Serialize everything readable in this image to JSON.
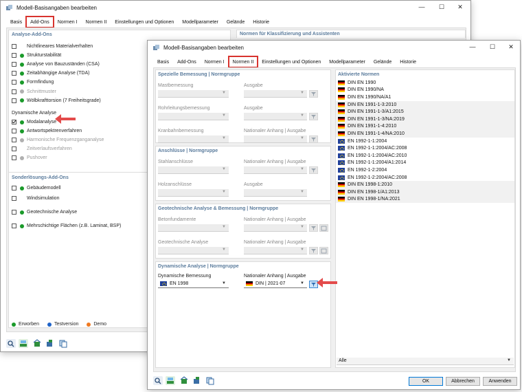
{
  "back_window": {
    "title": "Modell-Basisangaben bearbeiten",
    "controls": {
      "minimize": "—",
      "maximize": "☐",
      "close": "✕"
    },
    "tabs": [
      "Basis",
      "Add-Ons",
      "Normen I",
      "Normen II",
      "Einstellungen und Optionen",
      "Modellparameter",
      "Gelände",
      "Historie"
    ],
    "active_tab": "Add-Ons",
    "addons_title": "Analyse-Add-Ons",
    "right_title": "Normen für Klassifizierung und Assistenten",
    "addons": [
      {
        "label": "Nichtlineares Materialverhalten",
        "checked": false,
        "dot": "",
        "disabled": false
      },
      {
        "label": "Strukturstabilität",
        "checked": false,
        "dot": "#1a9a2a",
        "disabled": false
      },
      {
        "label": "Analyse von Bauzuständen (CSA)",
        "checked": false,
        "dot": "#1a9a2a",
        "disabled": false
      },
      {
        "label": "Zeitabhängige Analyse (TDA)",
        "checked": false,
        "dot": "#1a9a2a",
        "disabled": false
      },
      {
        "label": "Formfindung",
        "checked": false,
        "dot": "#1a9a2a",
        "disabled": false
      },
      {
        "label": "Schnittmuster",
        "checked": false,
        "dot": "#b0b0b0",
        "disabled": true
      },
      {
        "label": "Wölbkrafttorsion (7 Freiheitsgrade)",
        "checked": false,
        "dot": "#1a9a2a",
        "disabled": false
      }
    ],
    "dyn_title": "Dynamische Analyse",
    "dyn": [
      {
        "label": "Modalanalyse",
        "checked": true,
        "dot": "#1a9a2a",
        "disabled": false
      },
      {
        "label": "Antwortspektrenverfahren",
        "checked": false,
        "dot": "#1a9a2a",
        "disabled": false
      },
      {
        "label": "Harmonische Frequenzganganalyse",
        "checked": false,
        "dot": "#b0b0b0",
        "disabled": true
      },
      {
        "label": "Zeitverlaufsverfahren",
        "checked": false,
        "dot": "",
        "disabled": true
      },
      {
        "label": "Pushover",
        "checked": false,
        "dot": "#b0b0b0",
        "disabled": true
      }
    ],
    "special_title": "Sonderlösungs-Add-Ons",
    "special": [
      {
        "label": "Gebäudemodell",
        "checked": false,
        "dot": "#1a9a2a"
      },
      {
        "label": "Windsimulation",
        "checked": false,
        "dot": ""
      },
      {
        "label": "Geotechnische Analyse",
        "checked": false,
        "dot": "#1a9a2a"
      },
      {
        "label": "Mehrschichtige Flächen (z.B. Laminat, BSP)",
        "checked": false,
        "dot": "#1a9a2a"
      }
    ],
    "legend": [
      {
        "label": "Erworben",
        "color": "#1a9a2a"
      },
      {
        "label": "Testversion",
        "color": "#1f63c8"
      },
      {
        "label": "Demo",
        "color": "#f07a22"
      }
    ]
  },
  "front_window": {
    "title": "Modell-Basisangaben bearbeiten",
    "controls": {
      "minimize": "—",
      "maximize": "☐",
      "close": "✕"
    },
    "tabs": [
      "Basis",
      "Add-Ons",
      "Normen I",
      "Normen II",
      "Einstellungen und Optionen",
      "Modellparameter",
      "Gelände",
      "Historie"
    ],
    "active_tab": "Normen II",
    "groups": {
      "special": {
        "title": "Spezielle Bemessung | Normgruppe",
        "f1": "Mastbemessung",
        "f2": "Rohrleitungsbemessung",
        "f3": "Kranbahnbemessung",
        "o1": "Ausgabe",
        "o2": "Ausgabe",
        "o3": "Nationaler Anhang | Ausgabe"
      },
      "conn": {
        "title": "Anschlüsse | Normgruppe",
        "f1": "Stahlanschlüsse",
        "f2": "Holzanschlüsse",
        "o1": "Nationaler Anhang | Ausgabe",
        "o2": "Ausgabe"
      },
      "geo": {
        "title": "Geotechnische Analyse & Bemessung | Normgruppe",
        "f1": "Betonfundamente",
        "f2": "Geotechnische Analyse",
        "o1": "Nationaler Anhang | Ausgabe",
        "o2": "Nationaler Anhang | Ausgabe"
      },
      "dyn": {
        "title": "Dynamische Analyse | Normgruppe",
        "f1": "Dynamische Bemessung",
        "o1": "Nationaler Anhang | Ausgabe",
        "value": "EN 1998",
        "annex": "DIN | 2021-07"
      }
    },
    "norms_title": "Aktivierte Normen",
    "norms": [
      {
        "name": "DIN EN 1990",
        "flag": "de"
      },
      {
        "name": "DIN EN 1990/NA",
        "flag": "de"
      },
      {
        "name": "DIN EN 1990/NA/A1",
        "flag": "de"
      },
      {
        "name": "DIN EN 1991-1-3:2010",
        "flag": "de"
      },
      {
        "name": "DIN EN 1991-1-3/A1:2015",
        "flag": "de"
      },
      {
        "name": "DIN EN 1991-1-3/NA:2019",
        "flag": "de"
      },
      {
        "name": "DIN EN 1991-1-4:2010",
        "flag": "de"
      },
      {
        "name": "DIN EN 1991-1-4/NA:2010",
        "flag": "de"
      },
      {
        "name": "EN 1992-1-1:2004",
        "flag": "eu"
      },
      {
        "name": "EN 1992-1-1:2004/AC:2008",
        "flag": "eu"
      },
      {
        "name": "EN 1992-1-1:2004/AC:2010",
        "flag": "eu"
      },
      {
        "name": "EN 1992-1-1:2004/A1:2014",
        "flag": "eu"
      },
      {
        "name": "EN 1992-1-2:2004",
        "flag": "eu"
      },
      {
        "name": "EN 1992-1-2:2004/AC:2008",
        "flag": "eu"
      },
      {
        "name": "DIN EN 1998-1:2010",
        "flag": "de"
      },
      {
        "name": "DIN EN 1998-1/A1:2013",
        "flag": "de"
      },
      {
        "name": "DIN EN 1998-1/NA:2021",
        "flag": "de"
      }
    ],
    "filter_value": "Alle",
    "buttons": {
      "ok": "OK",
      "cancel": "Abbrechen",
      "apply": "Anwenden"
    }
  }
}
